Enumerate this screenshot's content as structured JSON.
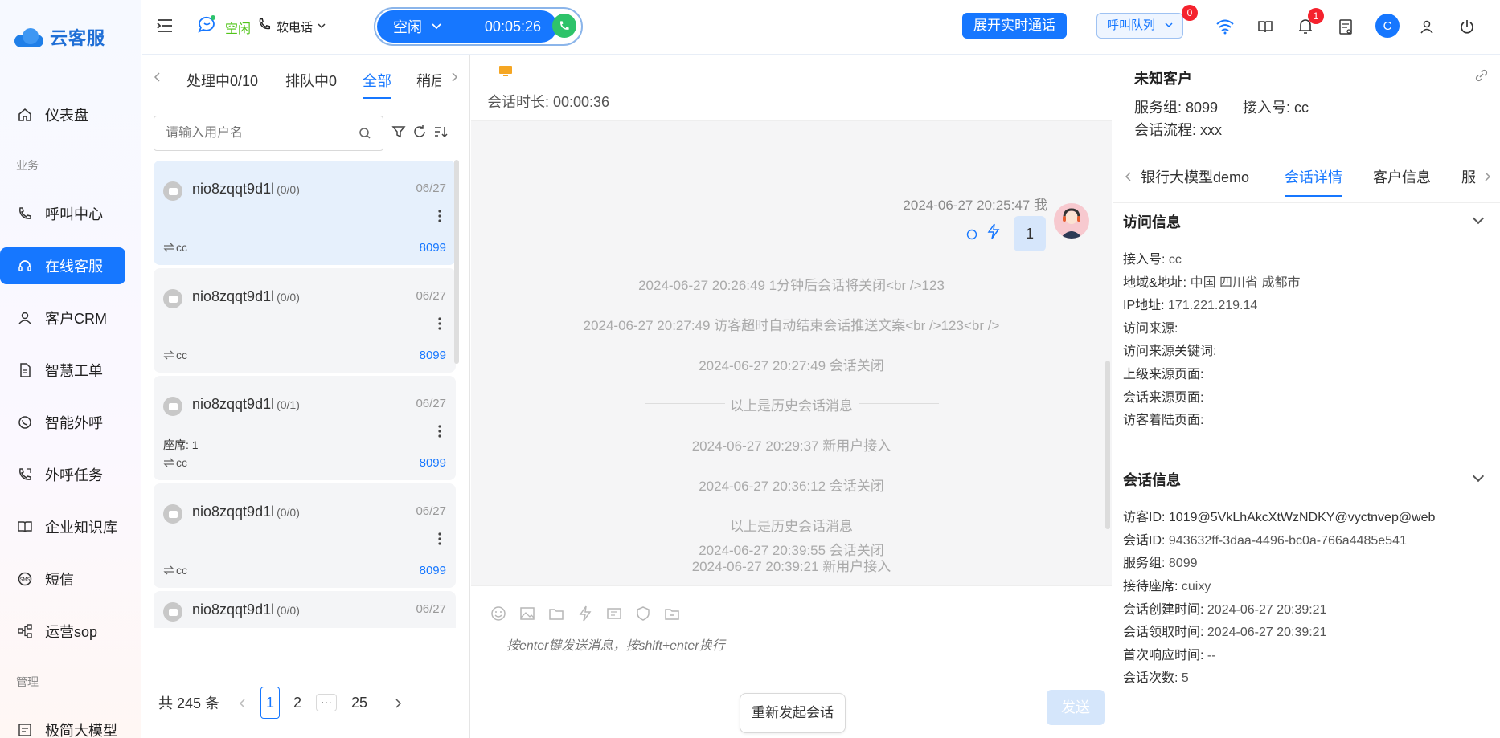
{
  "app": {
    "name": "云客服"
  },
  "sidebar": {
    "items": [
      {
        "label": "仪表盘",
        "icon": "home-icon"
      },
      {
        "label": "呼叫中心",
        "icon": "phone-icon"
      },
      {
        "label": "在线客服",
        "icon": "headset-icon",
        "active": true
      },
      {
        "label": "客户CRM",
        "icon": "user-icon"
      },
      {
        "label": "智慧工单",
        "icon": "document-icon"
      },
      {
        "label": "智能外呼",
        "icon": "whatsapp-icon"
      },
      {
        "label": "外呼任务",
        "icon": "outbound-call-icon"
      },
      {
        "label": "企业知识库",
        "icon": "book-icon"
      },
      {
        "label": "短信",
        "icon": "sms-icon"
      },
      {
        "label": "运营sop",
        "icon": "flow-icon"
      },
      {
        "label": "极简大模型",
        "icon": "model-icon"
      }
    ],
    "sections": {
      "business": "业务",
      "manage": "管理"
    }
  },
  "topbar": {
    "status_idle": "空闲",
    "softphone": "软电话",
    "call_status": "空闲",
    "timer": "00:05:26",
    "realtime_btn": "展开实时通话",
    "queue_btn": "呼叫队列",
    "queue_badge": "0",
    "notify_badge": "1",
    "user_initial": "C",
    "accent": "#1677ff"
  },
  "list": {
    "tabs": [
      "处理中0/10",
      "排队中0",
      "全部",
      "稍后"
    ],
    "active_tab": "全部",
    "search_placeholder": "请输入用户名",
    "cards": [
      {
        "name": "nio8zqqt9d1l",
        "count": "(0/0)",
        "date": "06/27",
        "channel": "cc",
        "group": "8099",
        "seat": ""
      },
      {
        "name": "nio8zqqt9d1l",
        "count": "(0/0)",
        "date": "06/27",
        "channel": "cc",
        "group": "8099",
        "seat": ""
      },
      {
        "name": "nio8zqqt9d1l",
        "count": "(0/1)",
        "date": "06/27",
        "channel": "cc",
        "group": "8099",
        "seat": "座席: 1"
      },
      {
        "name": "nio8zqqt9d1l",
        "count": "(0/0)",
        "date": "06/27",
        "channel": "cc",
        "group": "8099",
        "seat": ""
      },
      {
        "name": "nio8zqqt9d1l",
        "count": "(0/0)",
        "date": "06/27",
        "channel": "",
        "group": "",
        "seat": ""
      }
    ],
    "pager": {
      "total": "共 245 条",
      "pages": [
        "1",
        "2",
        "···",
        "25"
      ],
      "current": "1"
    }
  },
  "chat": {
    "duration": "会话时长: 00:00:36",
    "my_msg_time": "2024-06-27 20:25:47 我",
    "my_msg": "1",
    "system_messages": [
      "2024-06-27 20:26:49 1分钟后会话将关闭<br />123",
      "2024-06-27 20:27:49 访客超时自动结束会话推送文案<br />123<br />",
      "2024-06-27 20:27:49 会话关闭",
      "以上是历史会话消息",
      "2024-06-27 20:29:37 新用户接入",
      "2024-06-27 20:36:12 会话关闭",
      "以上是历史会话消息",
      "2024-06-27 20:39:21 新用户接入",
      "2024-06-27 20:39:55 会话关闭"
    ],
    "input_placeholder": "按enter键发送消息，按shift+enter换行",
    "restart_btn": "重新发起会话",
    "send_btn": "发送"
  },
  "right": {
    "customer": "未知客户",
    "service_group": "服务组:  8099",
    "access_no": "接入号:  cc",
    "flow": "会话流程:  xxx",
    "tabs": [
      "银行大模型demo",
      "会话详情",
      "客户信息",
      "服"
    ],
    "active_tab": "会话详情",
    "visit": {
      "title": "访问信息",
      "fields": [
        {
          "k": "接入号:",
          "v": "cc"
        },
        {
          "k": "地域&地址:",
          "v": "中国 四川省 成都市"
        },
        {
          "k": "IP地址:",
          "v": "171.221.219.14"
        },
        {
          "k": "访问来源:",
          "v": ""
        },
        {
          "k": "访问来源关键词:",
          "v": ""
        },
        {
          "k": "上级来源页面:",
          "v": ""
        },
        {
          "k": "会话来源页面:",
          "v": ""
        },
        {
          "k": "访客着陆页面:",
          "v": ""
        }
      ]
    },
    "session": {
      "title": "会话信息",
      "fields": [
        {
          "k": "访客ID:",
          "v": "1019@5VkLhAkcXtWzNDKY@vyctnvep@web"
        },
        {
          "k": "会话ID:",
          "v": "943632ff-3daa-4496-bc0a-766a4485e541"
        },
        {
          "k": "服务组:",
          "v": "8099"
        },
        {
          "k": "接待座席:",
          "v": "cuixy"
        },
        {
          "k": "会话创建时间:",
          "v": "2024-06-27 20:39:21"
        },
        {
          "k": "会话领取时间:",
          "v": "2024-06-27 20:39:21"
        },
        {
          "k": "首次响应时间:",
          "v": "--"
        },
        {
          "k": "会话次数:",
          "v": "5"
        }
      ]
    }
  }
}
